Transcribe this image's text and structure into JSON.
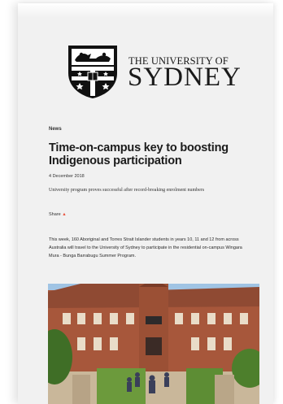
{
  "header": {
    "university_line": "THE UNIVERSITY OF",
    "university_name": "SYDNEY"
  },
  "article": {
    "kicker": "News",
    "title": "Time-on-campus key to boosting Indigenous participation",
    "date": "4 December 2018",
    "standfirst": "University program proves successful after record-breaking enrolment numbers",
    "share_label": "Share",
    "body": "This week, 160 Aboriginal and Torres Strait Islander students in years 10, 11 and 12 from across Australia will travel to the University of Sydney to participate in the residential on-campus Wingara Mura - Bunga Barrabugu Summer Program."
  },
  "colors": {
    "sheet": "#f1f1f1",
    "text": "#1b1b1b",
    "share_accent": "#e8533f"
  },
  "icons": [
    "university-crest-icon",
    "share-icon"
  ]
}
